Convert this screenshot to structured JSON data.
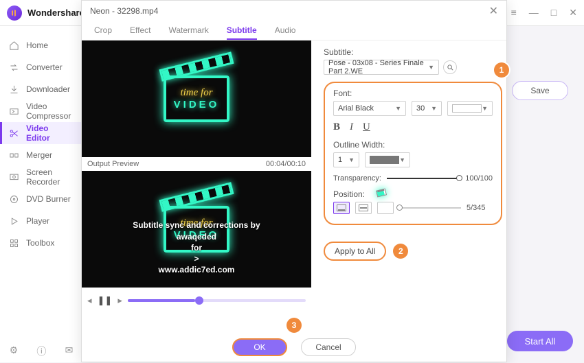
{
  "app": {
    "brand": "Wondershare"
  },
  "win": {
    "hamburger": "≡",
    "min": "—",
    "max": "□",
    "close": "✕"
  },
  "sidebar": {
    "items": [
      {
        "label": "Home"
      },
      {
        "label": "Converter"
      },
      {
        "label": "Downloader"
      },
      {
        "label": "Video Compressor"
      },
      {
        "label": "Video Editor"
      },
      {
        "label": "Merger"
      },
      {
        "label": "Screen Recorder"
      },
      {
        "label": "DVD Burner"
      },
      {
        "label": "Player"
      },
      {
        "label": "Toolbox"
      }
    ]
  },
  "main": {
    "save": "Save",
    "start_all": "Start All"
  },
  "modal": {
    "title": "Neon - 32298.mp4",
    "close": "✕",
    "tabs": [
      "Crop",
      "Effect",
      "Watermark",
      "Subtitle",
      "Audio"
    ],
    "output_preview": "Output Preview",
    "timecode": "00:04/00:10",
    "neon1": "time for",
    "neon2": "VIDEO",
    "sub1": "Subtitle sync and corrections by",
    "sub2": "awaqeded",
    "sub3": "for",
    "sub4": ">",
    "sub5": "www.addic7ed.com",
    "subtitle_lbl": "Subtitle:",
    "subtitle_file": "Pose - 03x08 - Series Finale Part 2.WE",
    "font_lbl": "Font:",
    "font_name": "Arial Black",
    "font_size": "30",
    "bold": "B",
    "italic": "I",
    "underline": "U",
    "outline_lbl": "Outline Width:",
    "outline_w": "1",
    "transparency_lbl": "Transparency:",
    "transparency_val": "100/100",
    "position_lbl": "Position:",
    "position_val": "5/345",
    "apply": "Apply to All",
    "ok": "OK",
    "cancel": "Cancel",
    "c1": "1",
    "c2": "2",
    "c3": "3"
  }
}
